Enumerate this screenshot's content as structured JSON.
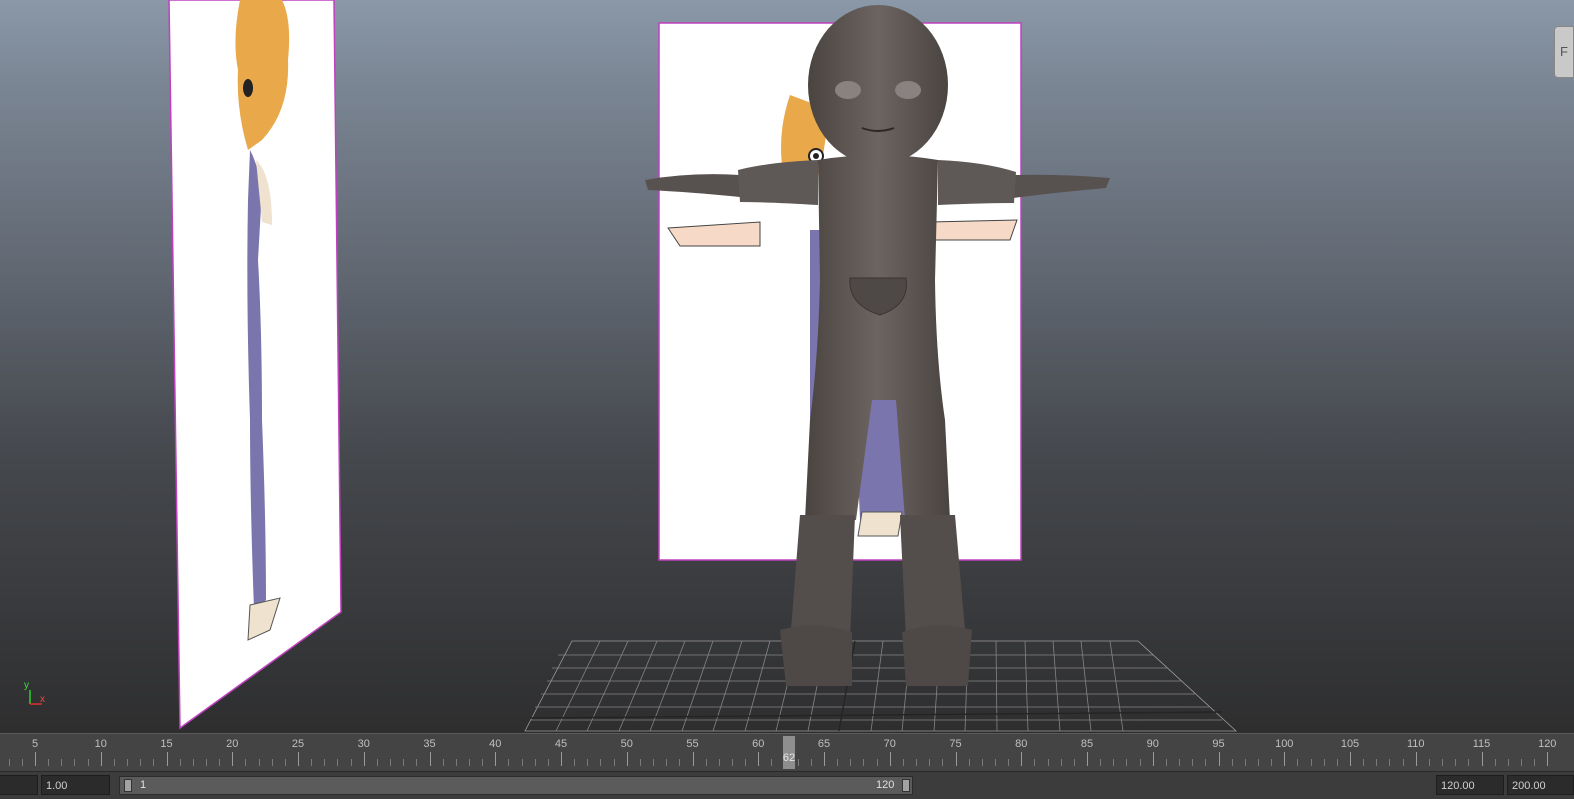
{
  "viewport": {
    "axis": {
      "y_label": "y",
      "x_label": "x"
    },
    "corner_tab_label": "F",
    "reference_images": [
      "side-view-sheet",
      "front-view-sheet"
    ]
  },
  "timeline": {
    "ticks": [
      "5",
      "10",
      "15",
      "20",
      "25",
      "30",
      "35",
      "40",
      "45",
      "50",
      "55",
      "60",
      "65",
      "70",
      "75",
      "80",
      "85",
      "90",
      "95",
      "100",
      "105",
      "110",
      "115",
      "120"
    ],
    "current_frame": "62"
  },
  "range": {
    "start_field": "1.00",
    "range_start": "1",
    "range_end": "120",
    "end_field": "120.00",
    "anim_end_field": "200.00"
  }
}
